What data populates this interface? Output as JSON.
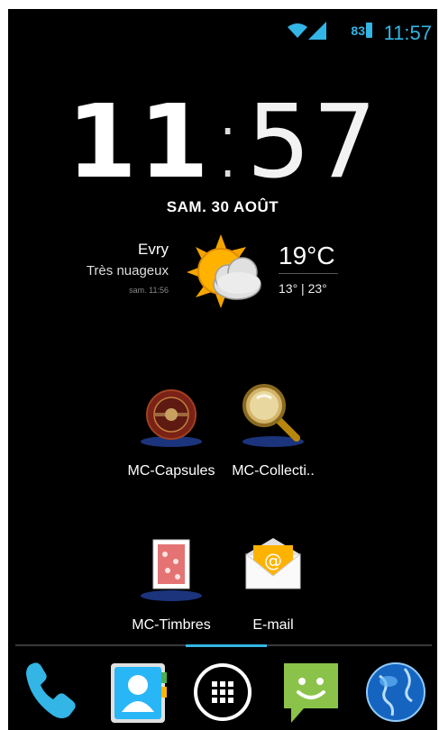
{
  "status_bar": {
    "battery": "83",
    "time": "11:57"
  },
  "clock": {
    "hours": "11",
    "separator": ":",
    "minutes": "57"
  },
  "date": "SAM. 30 AOÛT",
  "weather": {
    "city": "Evry",
    "condition": "Très nuageux",
    "updated": "sam. 11:56",
    "temperature": "19°C",
    "range": "13° | 23°",
    "icon": "partly-cloudy-icon"
  },
  "apps": [
    {
      "label": "MC-Capsules",
      "icon": "capsule-icon"
    },
    {
      "label": "MC-Collecti..",
      "icon": "magnifier-icon"
    },
    {
      "label": "MC-Timbres",
      "icon": "stamp-icon"
    },
    {
      "label": "E-mail",
      "icon": "email-icon"
    }
  ],
  "dock": [
    {
      "name": "phone",
      "icon": "phone-icon"
    },
    {
      "name": "contacts",
      "icon": "contacts-icon"
    },
    {
      "name": "app-drawer",
      "icon": "app-drawer-icon"
    },
    {
      "name": "messaging",
      "icon": "messaging-icon"
    },
    {
      "name": "browser",
      "icon": "globe-icon"
    }
  ],
  "colors": {
    "accent": "#33b5e5",
    "background": "#000000",
    "messaging_green": "#8bc34a"
  }
}
